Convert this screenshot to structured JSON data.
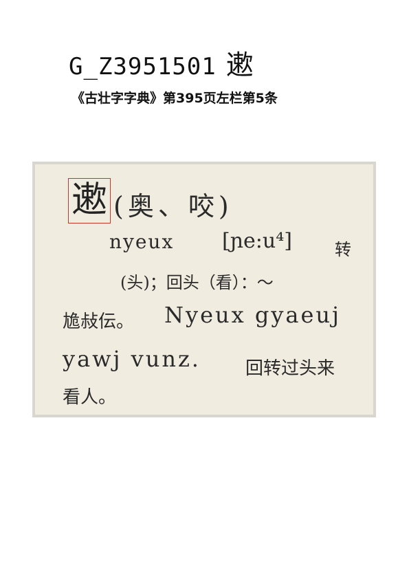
{
  "header": {
    "code": "G_Z3951501",
    "glyph": "遬",
    "source": "《古壮字字典》第395页左栏第5条"
  },
  "entry": {
    "head_char": "遬",
    "variants": "(奥、咬)",
    "romanization": "nyeux",
    "ipa": "[ɲe:u⁴]",
    "gloss_part1": "转",
    "gloss_part2": "(头)；回头（看）：～",
    "example_chars": "尯敊伝。",
    "example_roman_a": "Nyeux gyaeuj",
    "example_roman_b": "yawj vunz.",
    "translation_a": "回转过头来",
    "translation_b": "看人。"
  }
}
